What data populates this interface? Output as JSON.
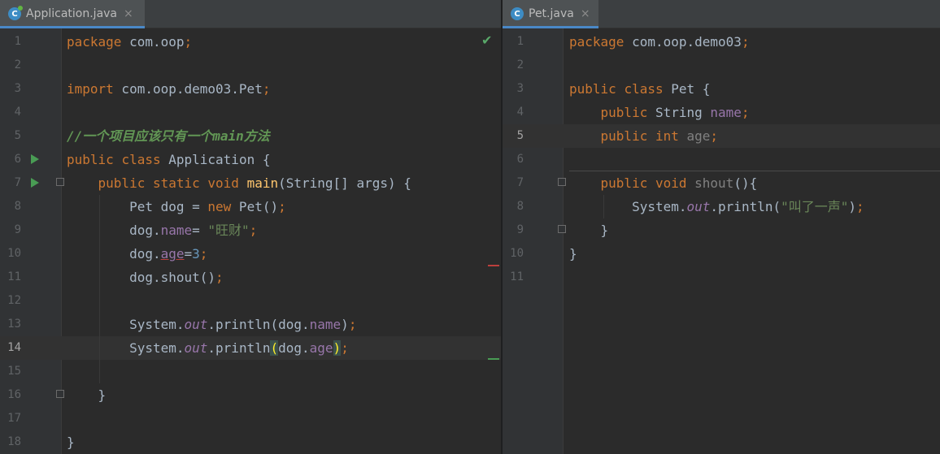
{
  "left": {
    "tab": {
      "icon": "C",
      "title": "Application.java",
      "close": "×"
    },
    "lines": [
      {
        "n": "1",
        "code": [
          {
            "t": "package",
            "c": "kw"
          },
          {
            "t": " com.oop"
          },
          {
            "t": ";",
            "c": "kw"
          }
        ]
      },
      {
        "n": "2",
        "code": []
      },
      {
        "n": "3",
        "code": [
          {
            "t": "import",
            "c": "kw"
          },
          {
            "t": " com.oop.demo03.Pet"
          },
          {
            "t": ";",
            "c": "kw"
          }
        ]
      },
      {
        "n": "4",
        "code": []
      },
      {
        "n": "5",
        "code": [
          {
            "t": "//一个项目应该只有一个main方法",
            "c": "cmt"
          }
        ]
      },
      {
        "n": "6",
        "code": [
          {
            "t": "public",
            "c": "kw"
          },
          {
            "t": " "
          },
          {
            "t": "class",
            "c": "kw"
          },
          {
            "t": " Application {"
          }
        ]
      },
      {
        "n": "7",
        "code": [
          {
            "t": "    "
          },
          {
            "t": "public",
            "c": "kw"
          },
          {
            "t": " "
          },
          {
            "t": "static",
            "c": "kw"
          },
          {
            "t": " "
          },
          {
            "t": "void",
            "c": "kw"
          },
          {
            "t": " "
          },
          {
            "t": "main",
            "c": "mth"
          },
          {
            "t": "(String[] args) {"
          }
        ]
      },
      {
        "n": "8",
        "code": [
          {
            "t": "        Pet dog = "
          },
          {
            "t": "new",
            "c": "kw"
          },
          {
            "t": " Pet()"
          },
          {
            "t": ";",
            "c": "kw"
          }
        ]
      },
      {
        "n": "9",
        "code": [
          {
            "t": "        dog."
          },
          {
            "t": "name",
            "c": "fld"
          },
          {
            "t": "= "
          },
          {
            "t": "\"旺财\"",
            "c": "str"
          },
          {
            "t": ";",
            "c": "kw"
          }
        ]
      },
      {
        "n": "10",
        "code": [
          {
            "t": "        dog."
          },
          {
            "t": "age",
            "c": "fld warn-under"
          },
          {
            "t": "="
          },
          {
            "t": "3",
            "c": "num"
          },
          {
            "t": ";",
            "c": "kw"
          }
        ]
      },
      {
        "n": "11",
        "code": [
          {
            "t": "        dog.shout()"
          },
          {
            "t": ";",
            "c": "kw"
          }
        ]
      },
      {
        "n": "12",
        "code": []
      },
      {
        "n": "13",
        "code": [
          {
            "t": "        System."
          },
          {
            "t": "out",
            "c": "sfld"
          },
          {
            "t": ".println(dog."
          },
          {
            "t": "name",
            "c": "fld"
          },
          {
            "t": ")"
          },
          {
            "t": ";",
            "c": "kw"
          }
        ]
      },
      {
        "n": "14",
        "code": [
          {
            "t": "        System."
          },
          {
            "t": "out",
            "c": "sfld"
          },
          {
            "t": ".println"
          },
          {
            "t": "(",
            "c": "paren-hl"
          },
          {
            "t": "dog."
          },
          {
            "t": "age",
            "c": "fld"
          },
          {
            "t": ")",
            "c": "paren-hl"
          },
          {
            "t": ";",
            "c": "kw"
          }
        ]
      },
      {
        "n": "15",
        "code": []
      },
      {
        "n": "16",
        "code": [
          {
            "t": "    }"
          }
        ]
      },
      {
        "n": "17",
        "code": []
      },
      {
        "n": "18",
        "code": [
          {
            "t": "}"
          }
        ]
      }
    ],
    "check_icon": "✔"
  },
  "right": {
    "tab": {
      "icon": "C",
      "title": "Pet.java",
      "close": "×"
    },
    "lines": [
      {
        "n": "1",
        "code": [
          {
            "t": "package",
            "c": "kw"
          },
          {
            "t": " com.oop.demo03"
          },
          {
            "t": ";",
            "c": "kw"
          }
        ]
      },
      {
        "n": "2",
        "code": []
      },
      {
        "n": "3",
        "code": [
          {
            "t": "public",
            "c": "kw"
          },
          {
            "t": " "
          },
          {
            "t": "class",
            "c": "kw"
          },
          {
            "t": " Pet {"
          }
        ]
      },
      {
        "n": "4",
        "code": [
          {
            "t": "    "
          },
          {
            "t": "public",
            "c": "kw"
          },
          {
            "t": " String "
          },
          {
            "t": "name",
            "c": "fld"
          },
          {
            "t": ";",
            "c": "kw"
          }
        ]
      },
      {
        "n": "5",
        "code": [
          {
            "t": "    "
          },
          {
            "t": "public",
            "c": "kw"
          },
          {
            "t": " "
          },
          {
            "t": "int",
            "c": "kw"
          },
          {
            "t": " "
          },
          {
            "t": "age",
            "c": "dim"
          },
          {
            "t": ";",
            "c": "kw"
          }
        ]
      },
      {
        "n": "6",
        "code": []
      },
      {
        "n": "7",
        "code": [
          {
            "t": "    "
          },
          {
            "t": "public",
            "c": "kw"
          },
          {
            "t": " "
          },
          {
            "t": "void",
            "c": "kw"
          },
          {
            "t": " "
          },
          {
            "t": "shout",
            "c": "dim"
          },
          {
            "t": "(){"
          }
        ]
      },
      {
        "n": "8",
        "code": [
          {
            "t": "        System."
          },
          {
            "t": "out",
            "c": "sfld"
          },
          {
            "t": ".println("
          },
          {
            "t": "\"叫了一声\"",
            "c": "str"
          },
          {
            "t": ")"
          },
          {
            "t": ";",
            "c": "kw"
          }
        ]
      },
      {
        "n": "9",
        "code": [
          {
            "t": "    }"
          }
        ]
      },
      {
        "n": "10",
        "code": [
          {
            "t": "}"
          }
        ]
      },
      {
        "n": "11",
        "code": []
      }
    ]
  },
  "colors": {
    "run_icon": "#499c54",
    "check": "#59a869",
    "error_stripe": "#bc3f3c",
    "ok_stripe": "#499c54",
    "tab_accent": "#4a88c7"
  }
}
